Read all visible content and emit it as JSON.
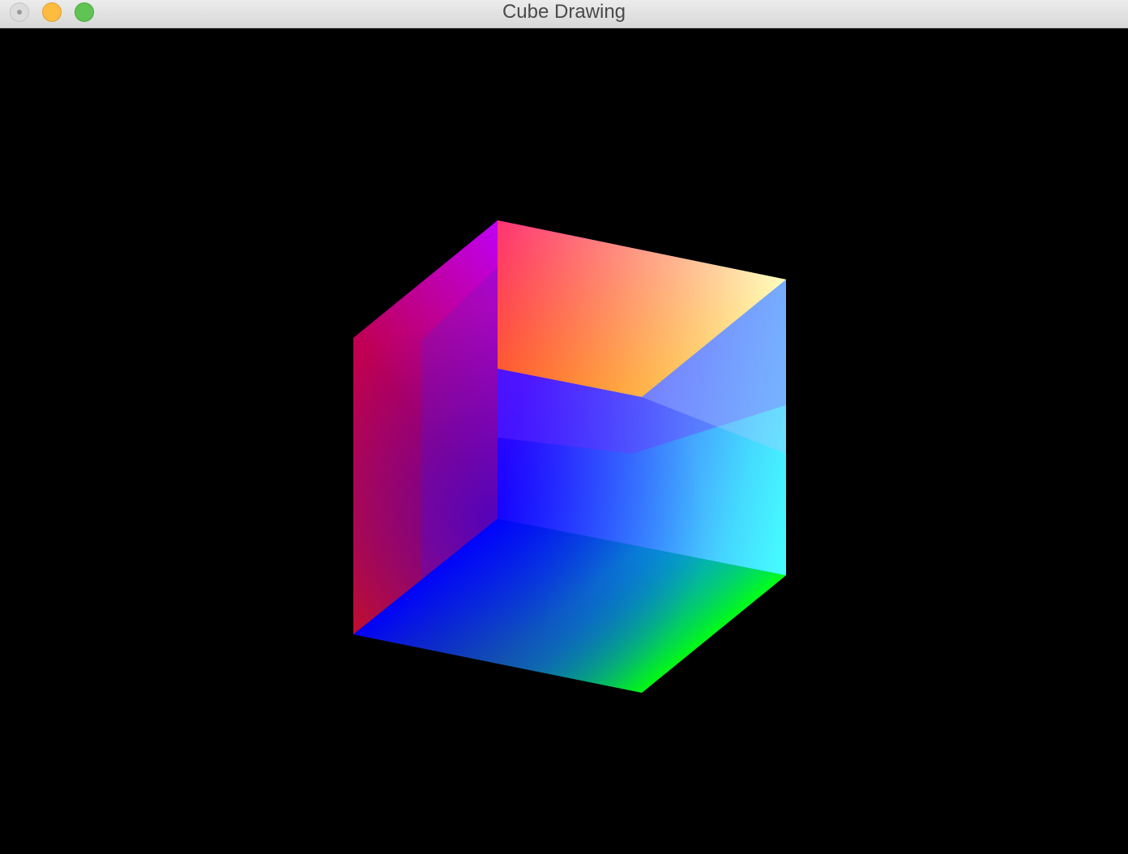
{
  "window": {
    "title": "Cube Drawing"
  },
  "colors": {
    "background": "#000000",
    "titlebar": "#e4e4e4",
    "close_button": "#dcdcdc",
    "minimize_button": "#fdbc40",
    "zoom_button": "#5fc454"
  },
  "scene": {
    "object": "rgb-color-cube",
    "vertex_colors": {
      "red": "#ff0000",
      "magenta": "#ff00ff",
      "white": "#ffffff",
      "yellow": "#ffff00",
      "black": "#000000",
      "blue": "#0000ff",
      "green": "#00ff00",
      "cyan": "#00ffff"
    }
  }
}
